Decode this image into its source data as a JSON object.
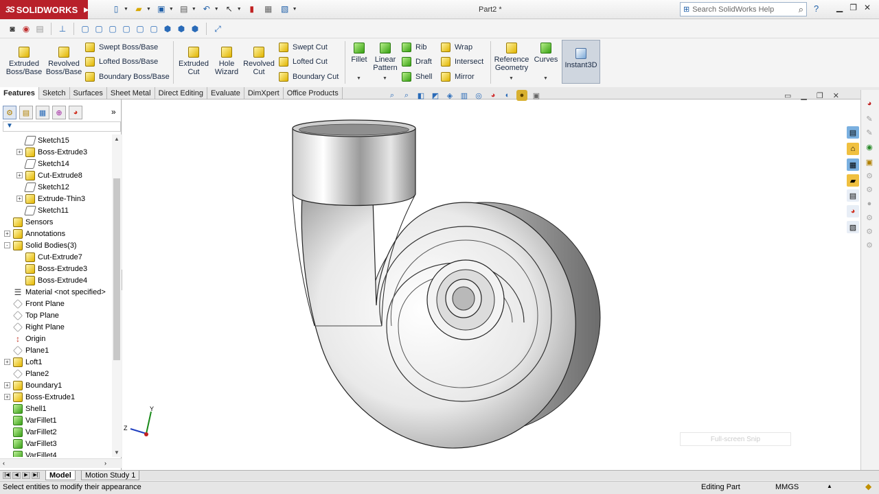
{
  "app": {
    "brand": "SOLIDWORKS",
    "document_title": "Part2 *"
  },
  "search": {
    "placeholder": "Search SolidWorks Help"
  },
  "command_manager": {
    "boss_group": [
      {
        "label": "Extruded Boss/Base",
        "icon": "extruded-boss-icon"
      },
      {
        "label": "Revolved Boss/Base",
        "icon": "revolved-boss-icon"
      }
    ],
    "boss_list": [
      "Swept Boss/Base",
      "Lofted Boss/Base",
      "Boundary Boss/Base"
    ],
    "cut_group": [
      {
        "label": "Extruded Cut",
        "icon": "extruded-cut-icon"
      },
      {
        "label": "Hole Wizard",
        "icon": "hole-wizard-icon"
      },
      {
        "label": "Revolved Cut",
        "icon": "revolved-cut-icon"
      }
    ],
    "cut_list": [
      "Swept Cut",
      "Lofted Cut",
      "Boundary Cut"
    ],
    "features_group": [
      {
        "label": "Fillet",
        "icon": "fillet-icon"
      },
      {
        "label": "Linear Pattern",
        "icon": "linear-pattern-icon"
      }
    ],
    "features_list_a": [
      "Rib",
      "Draft",
      "Shell"
    ],
    "features_list_b": [
      "Wrap",
      "Intersect",
      "Mirror"
    ],
    "ref_group": [
      {
        "label": "Reference Geometry",
        "icon": "reference-geometry-icon"
      },
      {
        "label": "Curves",
        "icon": "curves-icon"
      }
    ],
    "instant3d": "Instant3D"
  },
  "tabs": [
    "Features",
    "Sketch",
    "Surfaces",
    "Sheet Metal",
    "Direct Editing",
    "Evaluate",
    "DimXpert",
    "Office Products"
  ],
  "active_tab": "Features",
  "feature_tree": [
    {
      "label": "Sketch15",
      "indent": 1,
      "icon": "sketch",
      "expander": ""
    },
    {
      "label": "Boss-Extrude3",
      "indent": 1,
      "icon": "yellow",
      "expander": "+"
    },
    {
      "label": "Sketch14",
      "indent": 1,
      "icon": "sketch",
      "expander": ""
    },
    {
      "label": "Cut-Extrude8",
      "indent": 1,
      "icon": "yellow",
      "expander": "+"
    },
    {
      "label": "Sketch12",
      "indent": 1,
      "icon": "sketch",
      "expander": ""
    },
    {
      "label": "Extrude-Thin3",
      "indent": 1,
      "icon": "yellow",
      "expander": "+"
    },
    {
      "label": "Sketch11",
      "indent": 1,
      "icon": "sketch",
      "expander": ""
    },
    {
      "label": "Sensors",
      "indent": 0,
      "icon": "yellow",
      "expander": ""
    },
    {
      "label": "Annotations",
      "indent": 0,
      "icon": "yellow",
      "expander": "+"
    },
    {
      "label": "Solid Bodies(3)",
      "indent": 0,
      "icon": "yellow",
      "expander": "-"
    },
    {
      "label": "Cut-Extrude7",
      "indent": 1,
      "icon": "yellow",
      "expander": ""
    },
    {
      "label": "Boss-Extrude3",
      "indent": 1,
      "icon": "yellow",
      "expander": ""
    },
    {
      "label": "Boss-Extrude4",
      "indent": 1,
      "icon": "yellow",
      "expander": ""
    },
    {
      "label": "Material <not specified>",
      "indent": 0,
      "icon": "material",
      "expander": ""
    },
    {
      "label": "Front Plane",
      "indent": 0,
      "icon": "plane",
      "expander": ""
    },
    {
      "label": "Top Plane",
      "indent": 0,
      "icon": "plane",
      "expander": ""
    },
    {
      "label": "Right Plane",
      "indent": 0,
      "icon": "plane",
      "expander": ""
    },
    {
      "label": "Origin",
      "indent": 0,
      "icon": "origin",
      "expander": ""
    },
    {
      "label": "Plane1",
      "indent": 0,
      "icon": "plane",
      "expander": ""
    },
    {
      "label": "Loft1",
      "indent": 0,
      "icon": "yellow",
      "expander": "+"
    },
    {
      "label": "Plane2",
      "indent": 0,
      "icon": "plane",
      "expander": ""
    },
    {
      "label": "Boundary1",
      "indent": 0,
      "icon": "yellow",
      "expander": "+"
    },
    {
      "label": "Boss-Extrude1",
      "indent": 0,
      "icon": "yellow",
      "expander": "+"
    },
    {
      "label": "Shell1",
      "indent": 0,
      "icon": "green",
      "expander": ""
    },
    {
      "label": "VarFillet1",
      "indent": 0,
      "icon": "green",
      "expander": ""
    },
    {
      "label": "VarFillet2",
      "indent": 0,
      "icon": "green",
      "expander": ""
    },
    {
      "label": "VarFillet3",
      "indent": 0,
      "icon": "green",
      "expander": ""
    },
    {
      "label": "VarFillet4",
      "indent": 0,
      "icon": "green",
      "expander": ""
    }
  ],
  "triad": {
    "x": "Z",
    "y": "Y"
  },
  "snip_text": "Full-screen Snip",
  "bottom_tabs": [
    "Model",
    "Motion Study 1"
  ],
  "status": {
    "message": "Select entities to modify their appearance",
    "mode": "Editing Part",
    "units": "MMGS"
  },
  "colors": {
    "brand": "#b8202a",
    "accent": "#1f5fa8"
  }
}
